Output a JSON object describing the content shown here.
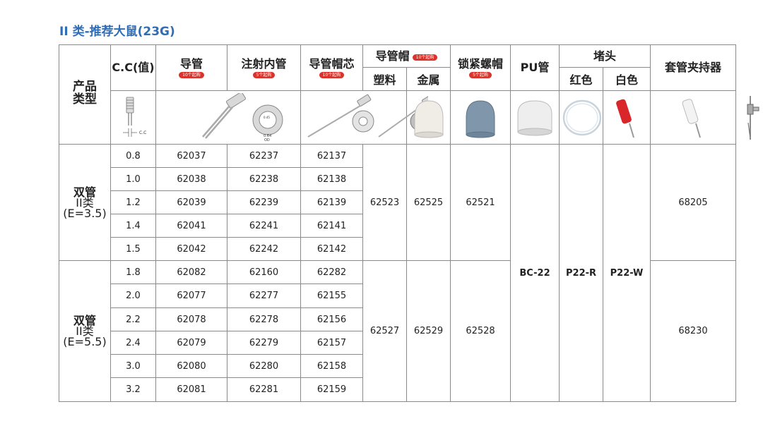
{
  "title": "II 类-推荐大鼠(23G)",
  "header": {
    "product_type": "产品类型",
    "cc": "C.C(值)",
    "guide": "导管",
    "guide_badge": "10个起购",
    "inner": "注射内管",
    "inner_badge": "5个起购",
    "cap_core": "导管帽芯",
    "cap_core_badge": "10个起购",
    "cap": "导管帽",
    "cap_badge": "10个起购",
    "cap_plastic": "塑料",
    "cap_metal": "金属",
    "lock_cap": "锁紧螺帽",
    "lock_badge": "5个起购",
    "pu": "PU管",
    "plug": "堵头",
    "plug_red": "红色",
    "plug_white": "白色",
    "holder": "套管夹持器"
  },
  "image_labels": {
    "cc_mark": "C.C",
    "od_value": "0.64",
    "od_label": "OD"
  },
  "groups": [
    {
      "name": "双管",
      "cls": "II类",
      "e": "(E=3.5)",
      "rows": [
        {
          "cc": "0.8",
          "guide": "62037",
          "inner": "62237",
          "core": "62137"
        },
        {
          "cc": "1.0",
          "guide": "62038",
          "inner": "62238",
          "core": "62138"
        },
        {
          "cc": "1.2",
          "guide": "62039",
          "inner": "62239",
          "core": "62139"
        },
        {
          "cc": "1.4",
          "guide": "62041",
          "inner": "62241",
          "core": "62141"
        },
        {
          "cc": "1.5",
          "guide": "62042",
          "inner": "62242",
          "core": "62142"
        }
      ],
      "cap_plastic": "62523",
      "cap_metal": "62525",
      "lock": "62521",
      "holder": "68205"
    },
    {
      "name": "双管",
      "cls": "II类",
      "e": "(E=5.5)",
      "rows": [
        {
          "cc": "1.8",
          "guide": "62082",
          "inner": "62160",
          "core": "62282"
        },
        {
          "cc": "2.0",
          "guide": "62077",
          "inner": "62277",
          "core": "62155"
        },
        {
          "cc": "2.2",
          "guide": "62078",
          "inner": "62278",
          "core": "62156"
        },
        {
          "cc": "2.4",
          "guide": "62079",
          "inner": "62279",
          "core": "62157"
        },
        {
          "cc": "3.0",
          "guide": "62080",
          "inner": "62280",
          "core": "62158"
        },
        {
          "cc": "3.2",
          "guide": "62081",
          "inner": "62281",
          "core": "62159"
        }
      ],
      "cap_plastic": "62527",
      "cap_metal": "62529",
      "lock": "62528",
      "holder": "68230"
    }
  ],
  "shared": {
    "pu": "BC-22",
    "plug_red": "P22-R",
    "plug_white": "P22-W"
  },
  "colors": {
    "title": "#2f6db5",
    "badge": "#d9332b",
    "border": "#8a8a8a"
  }
}
